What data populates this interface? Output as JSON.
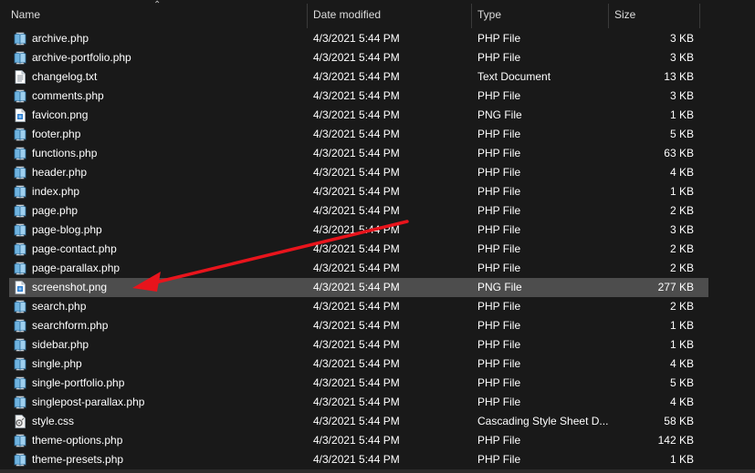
{
  "columns": {
    "name": "Name",
    "date": "Date modified",
    "type": "Type",
    "size": "Size"
  },
  "files": [
    {
      "name": "archive.php",
      "date": "4/3/2021 5:44 PM",
      "type": "PHP File",
      "size": "3 KB",
      "icon": "php-file-icon"
    },
    {
      "name": "archive-portfolio.php",
      "date": "4/3/2021 5:44 PM",
      "type": "PHP File",
      "size": "3 KB",
      "icon": "php-file-icon"
    },
    {
      "name": "changelog.txt",
      "date": "4/3/2021 5:44 PM",
      "type": "Text Document",
      "size": "13 KB",
      "icon": "text-file-icon"
    },
    {
      "name": "comments.php",
      "date": "4/3/2021 5:44 PM",
      "type": "PHP File",
      "size": "3 KB",
      "icon": "php-file-icon"
    },
    {
      "name": "favicon.png",
      "date": "4/3/2021 5:44 PM",
      "type": "PNG File",
      "size": "1 KB",
      "icon": "png-file-icon"
    },
    {
      "name": "footer.php",
      "date": "4/3/2021 5:44 PM",
      "type": "PHP File",
      "size": "5 KB",
      "icon": "php-file-icon"
    },
    {
      "name": "functions.php",
      "date": "4/3/2021 5:44 PM",
      "type": "PHP File",
      "size": "63 KB",
      "icon": "php-file-icon"
    },
    {
      "name": "header.php",
      "date": "4/3/2021 5:44 PM",
      "type": "PHP File",
      "size": "4 KB",
      "icon": "php-file-icon"
    },
    {
      "name": "index.php",
      "date": "4/3/2021 5:44 PM",
      "type": "PHP File",
      "size": "1 KB",
      "icon": "php-file-icon"
    },
    {
      "name": "page.php",
      "date": "4/3/2021 5:44 PM",
      "type": "PHP File",
      "size": "2 KB",
      "icon": "php-file-icon"
    },
    {
      "name": "page-blog.php",
      "date": "4/3/2021 5:44 PM",
      "type": "PHP File",
      "size": "3 KB",
      "icon": "php-file-icon"
    },
    {
      "name": "page-contact.php",
      "date": "4/3/2021 5:44 PM",
      "type": "PHP File",
      "size": "2 KB",
      "icon": "php-file-icon"
    },
    {
      "name": "page-parallax.php",
      "date": "4/3/2021 5:44 PM",
      "type": "PHP File",
      "size": "2 KB",
      "icon": "php-file-icon"
    },
    {
      "name": "screenshot.png",
      "date": "4/3/2021 5:44 PM",
      "type": "PNG File",
      "size": "277 KB",
      "icon": "png-file-icon",
      "selected": true
    },
    {
      "name": "search.php",
      "date": "4/3/2021 5:44 PM",
      "type": "PHP File",
      "size": "2 KB",
      "icon": "php-file-icon"
    },
    {
      "name": "searchform.php",
      "date": "4/3/2021 5:44 PM",
      "type": "PHP File",
      "size": "1 KB",
      "icon": "php-file-icon"
    },
    {
      "name": "sidebar.php",
      "date": "4/3/2021 5:44 PM",
      "type": "PHP File",
      "size": "1 KB",
      "icon": "php-file-icon"
    },
    {
      "name": "single.php",
      "date": "4/3/2021 5:44 PM",
      "type": "PHP File",
      "size": "4 KB",
      "icon": "php-file-icon"
    },
    {
      "name": "single-portfolio.php",
      "date": "4/3/2021 5:44 PM",
      "type": "PHP File",
      "size": "5 KB",
      "icon": "php-file-icon"
    },
    {
      "name": "singlepost-parallax.php",
      "date": "4/3/2021 5:44 PM",
      "type": "PHP File",
      "size": "4 KB",
      "icon": "php-file-icon"
    },
    {
      "name": "style.css",
      "date": "4/3/2021 5:44 PM",
      "type": "Cascading Style Sheet D...",
      "size": "58 KB",
      "icon": "css-file-icon"
    },
    {
      "name": "theme-options.php",
      "date": "4/3/2021 5:44 PM",
      "type": "PHP File",
      "size": "142 KB",
      "icon": "php-file-icon"
    },
    {
      "name": "theme-presets.php",
      "date": "4/3/2021 5:44 PM",
      "type": "PHP File",
      "size": "1 KB",
      "icon": "php-file-icon"
    }
  ],
  "colors": {
    "background": "#191919",
    "selected_row": "#4d4d4d",
    "arrow": "#e8141c"
  }
}
